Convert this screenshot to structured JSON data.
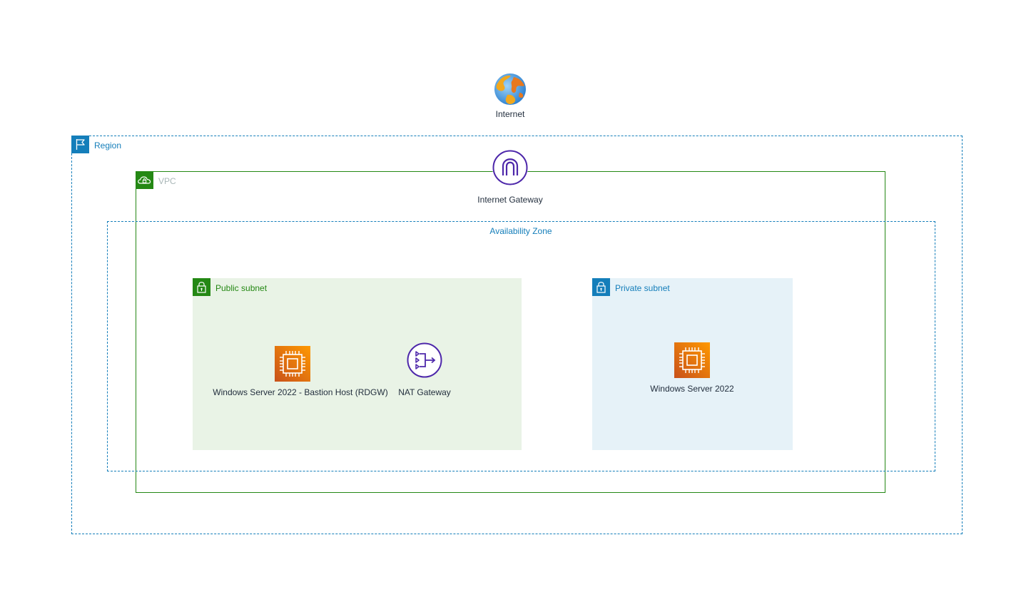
{
  "internet": {
    "label": "Internet",
    "icon": "globe-icon"
  },
  "region": {
    "label": "Region",
    "icon": "flag-icon",
    "color": "#147eba"
  },
  "vpc": {
    "label": "VPC",
    "icon": "cloud-lock-icon",
    "color": "#248814"
  },
  "internet_gateway": {
    "label": "Internet Gateway",
    "icon": "internet-gateway-icon",
    "color": "#4d27aa"
  },
  "availability_zone": {
    "label": "Availability Zone",
    "color": "#147eba"
  },
  "public_subnet": {
    "label": "Public subnet",
    "icon": "padlock-icon",
    "color": "#248814",
    "fill": "#e9f3e6",
    "nodes": [
      {
        "label": "Windows Server 2022 - Bastion Host (RDGW)",
        "icon": "ec2-instance-icon"
      },
      {
        "label": "NAT Gateway",
        "icon": "nat-gateway-icon"
      }
    ]
  },
  "private_subnet": {
    "label": "Private subnet",
    "icon": "padlock-icon",
    "color": "#147eba",
    "fill": "#e6f2f8",
    "nodes": [
      {
        "label": "Windows Server 2022",
        "icon": "ec2-instance-icon"
      }
    ]
  }
}
